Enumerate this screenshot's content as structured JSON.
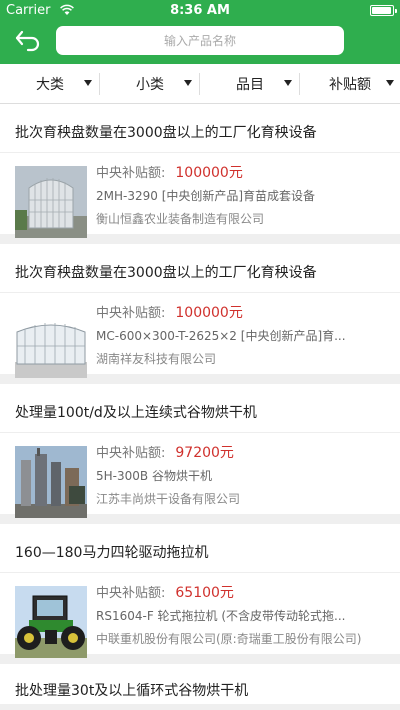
{
  "status": {
    "carrier": "Carrier",
    "time": "8:36 AM",
    "battery_level": 1.0
  },
  "header": {
    "search_placeholder": "输入产品名称",
    "search_value": ""
  },
  "filters": [
    {
      "label": "大类"
    },
    {
      "label": "小类"
    },
    {
      "label": "品目"
    },
    {
      "label": "补贴额"
    }
  ],
  "subsidy_label": "中央补贴额:",
  "items": [
    {
      "title": "批次育秧盘数量在3000盘以上的工厂化育秧设备",
      "amount": "100000元",
      "model": "2MH-3290 [中央创新产品]育苗成套设备",
      "company": "衡山恒鑫农业装备制造有限公司",
      "image": "greenhouse-photo"
    },
    {
      "title": "批次育秧盘数量在3000盘以上的工厂化育秧设备",
      "amount": "100000元",
      "model": "MC-600×300-T-2625×2 [中央创新产品]育...",
      "company": "湖南祥友科技有限公司",
      "image": "greenhouse-photo"
    },
    {
      "title": "处理量100t/d及以上连续式谷物烘干机",
      "amount": "97200元",
      "model": "5H-300B 谷物烘干机",
      "company": "江苏丰尚烘干设备有限公司",
      "image": "grain-dryer-photo"
    },
    {
      "title": "160—180马力四轮驱动拖拉机",
      "amount": "65100元",
      "model": "RS1604-F 轮式拖拉机 (不含皮带传动轮式拖...",
      "company": "中联重机股份有限公司(原:奇瑞重工股份有限公司)",
      "image": "tractor-photo"
    },
    {
      "title": "批处理量30t及以上循环式谷物烘干机"
    }
  ]
}
